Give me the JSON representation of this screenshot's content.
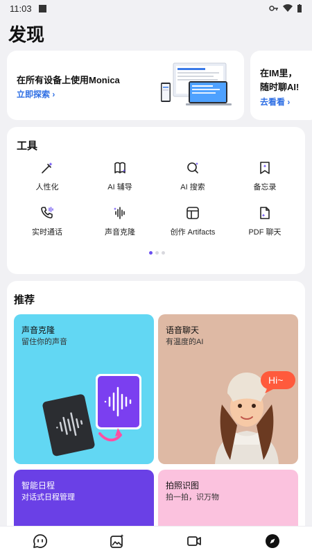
{
  "status": {
    "time": "11:03"
  },
  "page": {
    "title": "发现"
  },
  "banners": [
    {
      "title": "在所有设备上使用Monica",
      "link": "立即探索 ›"
    },
    {
      "title_line1": "在IM里，",
      "title_line2": "随时聊AI!",
      "link": "去看看 ›"
    }
  ],
  "tools": {
    "title": "工具",
    "items": [
      {
        "label": "人性化",
        "icon": "wand-icon"
      },
      {
        "label": "AI 辅导",
        "icon": "book-icon"
      },
      {
        "label": "AI 搜索",
        "icon": "search-sparkle-icon"
      },
      {
        "label": "备忘录",
        "icon": "bookmark-note-icon"
      },
      {
        "label": "实时通话",
        "icon": "phone-wave-icon"
      },
      {
        "label": "声音克隆",
        "icon": "waveform-icon"
      },
      {
        "label": "创作 Artifacts",
        "icon": "layout-icon"
      },
      {
        "label": "PDF 聊天",
        "icon": "pdf-file-icon"
      }
    ],
    "page_indicator": {
      "current": 1,
      "total": 3
    }
  },
  "recommend": {
    "title": "推荐",
    "tiles": [
      {
        "title": "声音克隆",
        "subtitle": "留住你的声音"
      },
      {
        "title": "语音聊天",
        "subtitle": "有温度的AI",
        "bubble": "Hi~"
      },
      {
        "title": "智能日程",
        "subtitle": "对话式日程管理"
      },
      {
        "title": "拍照识图",
        "subtitle": "拍一拍，识万物"
      }
    ]
  },
  "nav": [
    "chat-icon",
    "image-sparkle-icon",
    "video-icon",
    "discover-compass-icon"
  ],
  "colors": {
    "accent": "#6a4ff0",
    "link": "#2f6fe4",
    "voice_tile": "#62d7f3",
    "chat_tile": "#deb9a4",
    "schedule_tile": "#6a40e6",
    "photo_tile": "#fbc2de"
  }
}
